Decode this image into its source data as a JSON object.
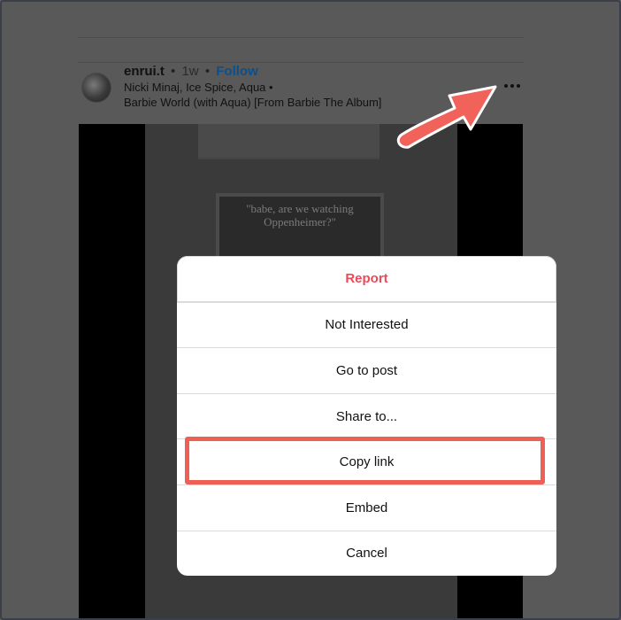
{
  "post": {
    "username": "enrui.t",
    "separator": "•",
    "age": "1w",
    "follow_label": "Follow",
    "artists": "Nicki Minaj, Ice Spice, Aqua •",
    "song": "Barbie World (with Aqua) [From Barbie The Album]",
    "more_icon": "more-horizontal-icon"
  },
  "video": {
    "caption": "\"babe, are we watching Oppenheimer?\""
  },
  "menu": {
    "items": [
      {
        "label": "Report"
      },
      {
        "label": "Not Interested"
      },
      {
        "label": "Go to post"
      },
      {
        "label": "Share to..."
      },
      {
        "label": "Copy link"
      },
      {
        "label": "Embed"
      },
      {
        "label": "Cancel"
      }
    ]
  },
  "annotation": {
    "arrow_color": "#f0625a",
    "highlight_color": "#ee5f56",
    "highlighted_item": "Copy link"
  },
  "colors": {
    "report": "#ed4956",
    "follow": "#0d4f8a",
    "overlay": "#595959"
  }
}
